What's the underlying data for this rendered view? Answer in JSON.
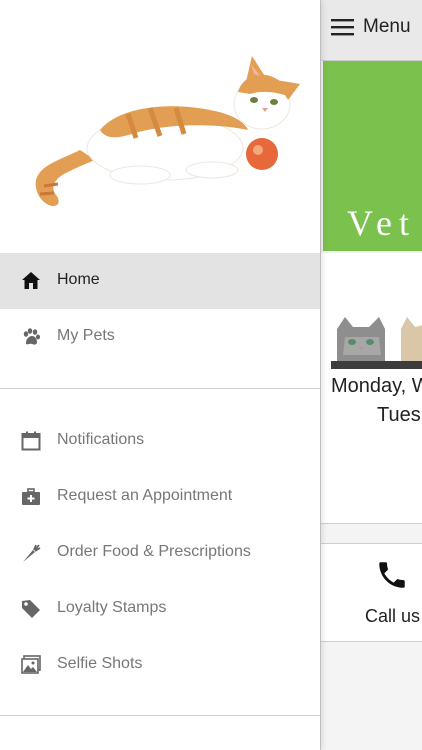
{
  "menu": {
    "label": "Menu"
  },
  "hero": {
    "title": "Vet"
  },
  "hours": {
    "line1": "Monday, W",
    "line2": "Tues"
  },
  "call": {
    "label": "Call us"
  },
  "nav": {
    "home": "Home",
    "pets": "My Pets",
    "notifications": "Notifications",
    "appointment": "Request an Appointment",
    "food": "Order Food & Prescriptions",
    "loyalty": "Loyalty Stamps",
    "selfie": "Selfie Shots"
  },
  "colors": {
    "brand_green": "#7bc14e",
    "active_row": "#e3e3e3",
    "icon_gray": "#666666"
  }
}
